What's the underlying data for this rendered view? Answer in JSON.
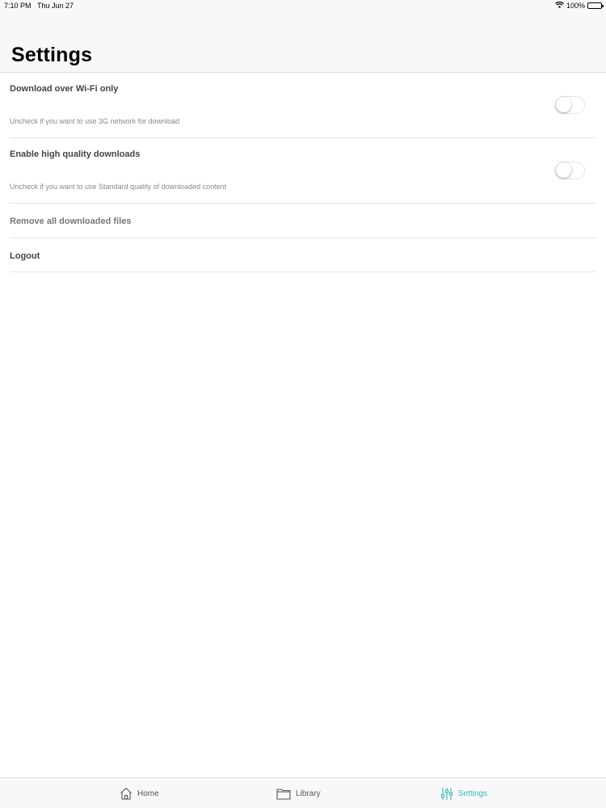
{
  "status_bar": {
    "time": "7:10 PM",
    "date": "Thu Jun 27",
    "battery": "100%",
    "wifi_icon": "wifi-icon",
    "battery_icon": "battery-icon"
  },
  "header": {
    "title": "Settings"
  },
  "settings": {
    "items": [
      {
        "title": "Download over Wi-Fi only",
        "subtitle": "Uncheck if you want to use 3G network for download",
        "toggle_on": false
      },
      {
        "title": "Enable high quality downloads",
        "subtitle": "Uncheck if you want to use Standard quality of downloaded content",
        "toggle_on": false
      }
    ],
    "remove_label": "Remove all downloaded files",
    "logout_label": "Logout"
  },
  "tab_bar": {
    "tabs": [
      {
        "label": "Home",
        "icon": "home-icon"
      },
      {
        "label": "Library",
        "icon": "folder-icon"
      },
      {
        "label": "Settings",
        "icon": "sliders-icon",
        "active": true
      }
    ],
    "active_color": "#3cb8b2"
  }
}
